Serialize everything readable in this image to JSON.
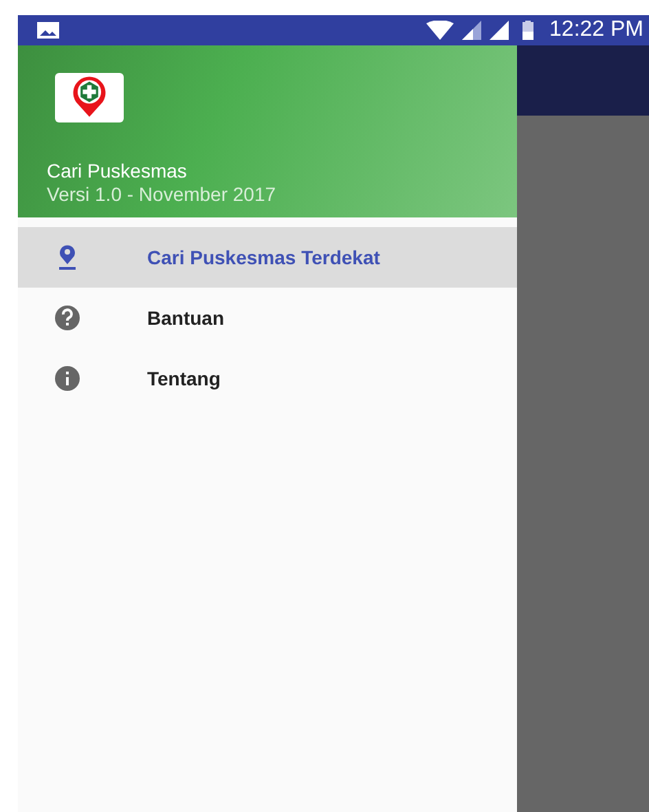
{
  "status_bar": {
    "time": "12:22 PM"
  },
  "drawer": {
    "header": {
      "title": "Cari Puskesmas",
      "subtitle": "Versi 1.0 - November 2017"
    },
    "items": [
      {
        "kind": "location",
        "label": "Cari Puskesmas Terdekat",
        "selected": true
      },
      {
        "kind": "help",
        "label": "Bantuan",
        "selected": false
      },
      {
        "kind": "info",
        "label": "Tentang",
        "selected": false
      }
    ]
  }
}
